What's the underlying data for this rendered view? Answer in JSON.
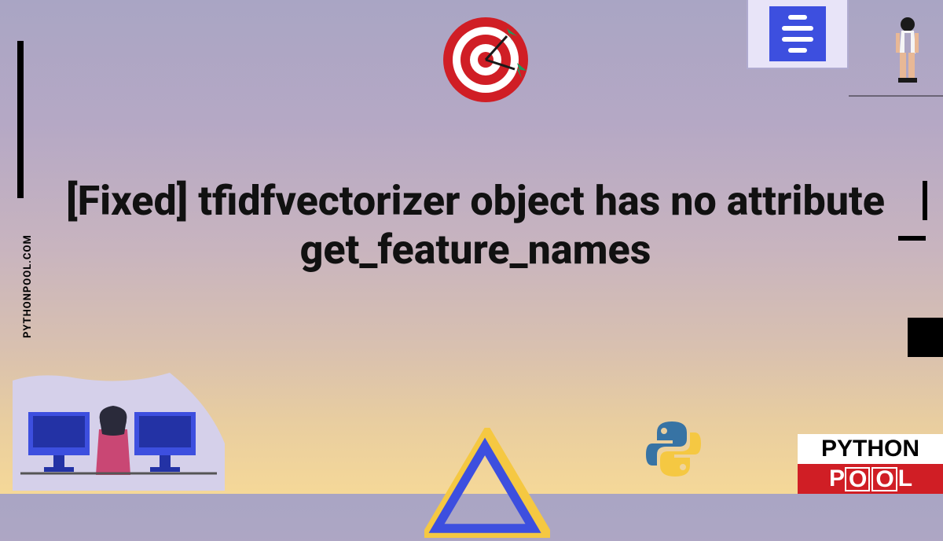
{
  "headline": "[Fixed] tfidfvectorizer object has no attribute get_feature_names",
  "site_url": "PYTHONPOOL.COM",
  "brand": {
    "line1": "PYTHON",
    "line2_p": "P",
    "line2_ool": "L"
  }
}
